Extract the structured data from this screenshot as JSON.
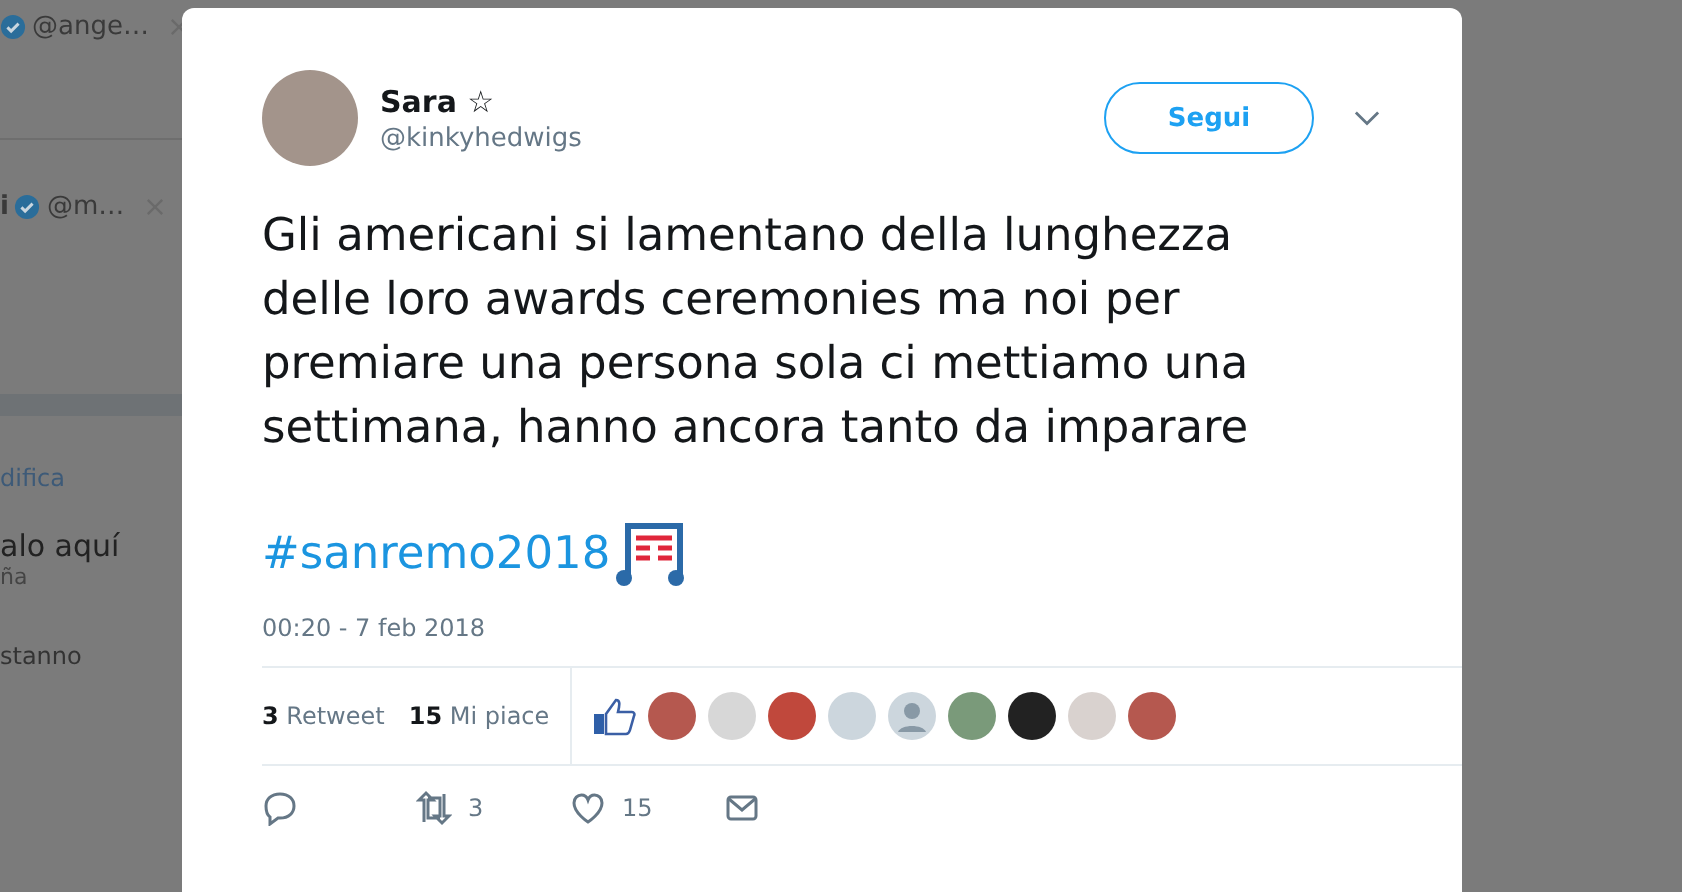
{
  "background": {
    "items": [
      {
        "kind": "account",
        "handle": "@ange…",
        "verified": true
      },
      {
        "kind": "account",
        "name": "i",
        "handle": "@m…",
        "verified": true
      },
      {
        "kind": "link",
        "text": "difica"
      },
      {
        "kind": "title",
        "text": "alo aquí",
        "subtitle": "ña"
      },
      {
        "kind": "note",
        "text": "stanno"
      }
    ]
  },
  "tweet": {
    "author": {
      "name": "Sara ☆",
      "handle": "@kinkyhedwigs"
    },
    "follow_button": "Segui",
    "text": "Gli americani si lamentano della lunghezza delle loro awards ceremonies ma noi per premiare una persona sola ci mettiamo una settimana, hanno ancora tanto da imparare",
    "hashtag": "#sanremo2018",
    "timestamp": "00:20 - 7 feb 2018",
    "stats": [
      {
        "count": "3",
        "label": "Retweet"
      },
      {
        "count": "15",
        "label": "Mi piace"
      }
    ],
    "likers": [
      {
        "kind": "photo"
      },
      {
        "kind": "photo"
      },
      {
        "kind": "photo"
      },
      {
        "kind": "photo"
      },
      {
        "kind": "default"
      },
      {
        "kind": "photo"
      },
      {
        "kind": "photo"
      },
      {
        "kind": "photo"
      },
      {
        "kind": "photo"
      }
    ],
    "actions": [
      {
        "kind": "reply"
      },
      {
        "kind": "retweet",
        "count": "3"
      },
      {
        "kind": "like",
        "count": "15"
      },
      {
        "kind": "message"
      }
    ]
  }
}
